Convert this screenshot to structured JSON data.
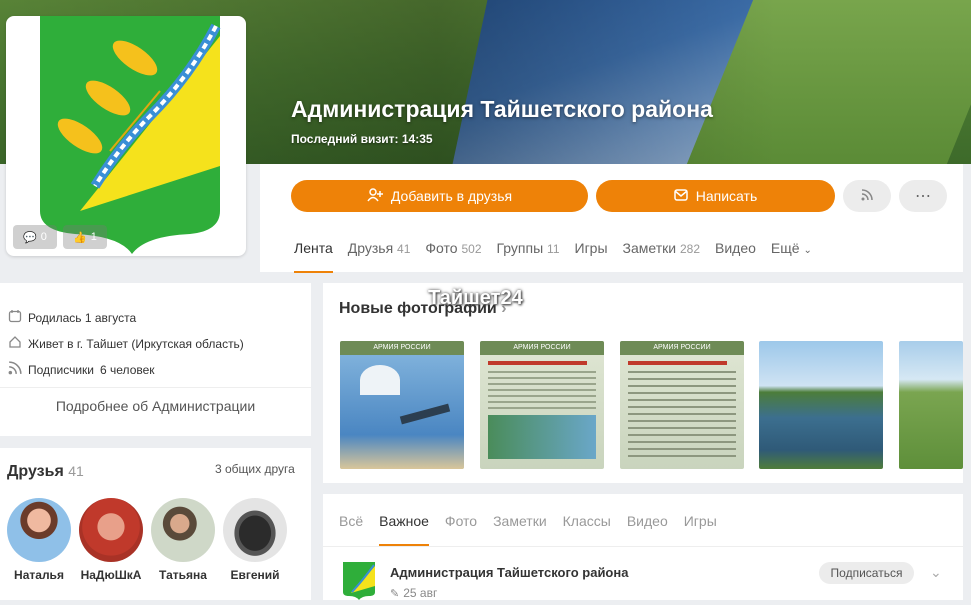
{
  "profile": {
    "name": "Администрация Тайшетского района",
    "last_visit": "Последний визит: 14:35",
    "avatar_comments": "0",
    "avatar_likes": "1"
  },
  "actions": {
    "add_friend": "Добавить в друзья",
    "write": "Написать"
  },
  "tabs": [
    {
      "label": "Лента",
      "count": ""
    },
    {
      "label": "Друзья",
      "count": "41"
    },
    {
      "label": "Фото",
      "count": "502"
    },
    {
      "label": "Группы",
      "count": "11"
    },
    {
      "label": "Игры",
      "count": ""
    },
    {
      "label": "Заметки",
      "count": "282"
    },
    {
      "label": "Видео",
      "count": ""
    },
    {
      "label": "Ещё",
      "count": ""
    }
  ],
  "info": {
    "birthday": "Родилась 1 августа",
    "lives": "Живет в г. Тайшет (Иркутская область)",
    "subscribers_prefix": "Подписчики",
    "subscribers_count": "6 человек",
    "more": "Подробнее об Администрации"
  },
  "friends": {
    "title": "Друзья",
    "count": "41",
    "common": "3 общих друга",
    "items": [
      {
        "name": "Наталья"
      },
      {
        "name": "НаДюШкА"
      },
      {
        "name": "Татьяна"
      },
      {
        "name": "Евгений"
      }
    ]
  },
  "photos": {
    "title": "Новые фотографии",
    "watermark": "Тайшет24",
    "poster_label": "АРМИЯ РОССИИ"
  },
  "feed": {
    "tabs": [
      "Всё",
      "Важное",
      "Фото",
      "Заметки",
      "Классы",
      "Видео",
      "Игры"
    ],
    "active_tab": "Важное",
    "post_author": "Администрация Тайшетского района",
    "post_date": "25 авг",
    "subscribe": "Подписаться"
  },
  "colors": {
    "accent": "#ee8208",
    "emblem_green": "#2fae3a",
    "emblem_yellow": "#f5e21c",
    "emblem_blue": "#3a8fd6"
  }
}
